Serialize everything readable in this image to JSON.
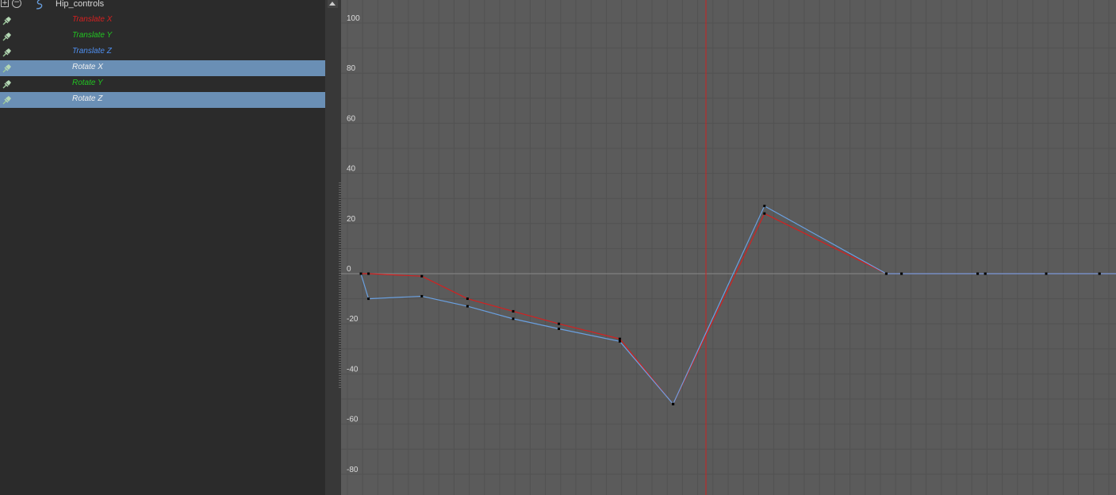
{
  "outliner": {
    "root": {
      "label": "Hip_controls",
      "expand_icon": "plus-box-icon",
      "collapse_icon": "minus-circle-icon",
      "node_icon": "curve-s-icon"
    },
    "channels": [
      {
        "label": "Translate X",
        "color": "#d42020",
        "selected": false
      },
      {
        "label": "Translate Y",
        "color": "#22c422",
        "selected": false
      },
      {
        "label": "Translate Z",
        "color": "#4f8ff0",
        "selected": false
      },
      {
        "label": "Rotate X",
        "color": "#f0f0f0",
        "selected": true
      },
      {
        "label": "Rotate Y",
        "color": "#22c422",
        "selected": false
      },
      {
        "label": "Rotate Z",
        "color": "#f0f0f0",
        "selected": true
      }
    ]
  },
  "graph": {
    "background": "#5b5b5b",
    "grid_color": "#525252",
    "zero_line_color": "#8a8a8a",
    "time_indicator_color": "#cc2222",
    "y_ticks": [
      100,
      80,
      60,
      40,
      20,
      0,
      -20,
      -40,
      -60,
      -80
    ]
  },
  "chart_data": {
    "type": "line",
    "ylim": [
      -88,
      110
    ],
    "series": [
      {
        "color": "#d42020",
        "keys": [
          [
            0,
            0
          ],
          [
            1,
            0
          ],
          [
            8,
            -1
          ],
          [
            14,
            -10
          ],
          [
            20,
            -15
          ],
          [
            26,
            -20
          ],
          [
            34,
            -26
          ],
          [
            41,
            -52
          ],
          [
            53,
            24
          ],
          [
            69,
            0
          ],
          [
            71,
            0
          ],
          [
            81,
            0
          ],
          [
            82,
            0
          ],
          [
            90,
            0
          ],
          [
            97,
            0
          ]
        ]
      },
      {
        "color": "#6aa0e0",
        "keys": [
          [
            0,
            0
          ],
          [
            1,
            -10
          ],
          [
            8,
            -9
          ],
          [
            14,
            -13
          ],
          [
            20,
            -18
          ],
          [
            26,
            -22
          ],
          [
            34,
            -27
          ],
          [
            41,
            -52
          ],
          [
            53,
            27
          ],
          [
            69,
            0
          ],
          [
            71,
            0
          ],
          [
            81,
            0
          ],
          [
            82,
            0
          ],
          [
            90,
            0
          ],
          [
            97,
            0
          ]
        ]
      }
    ]
  }
}
